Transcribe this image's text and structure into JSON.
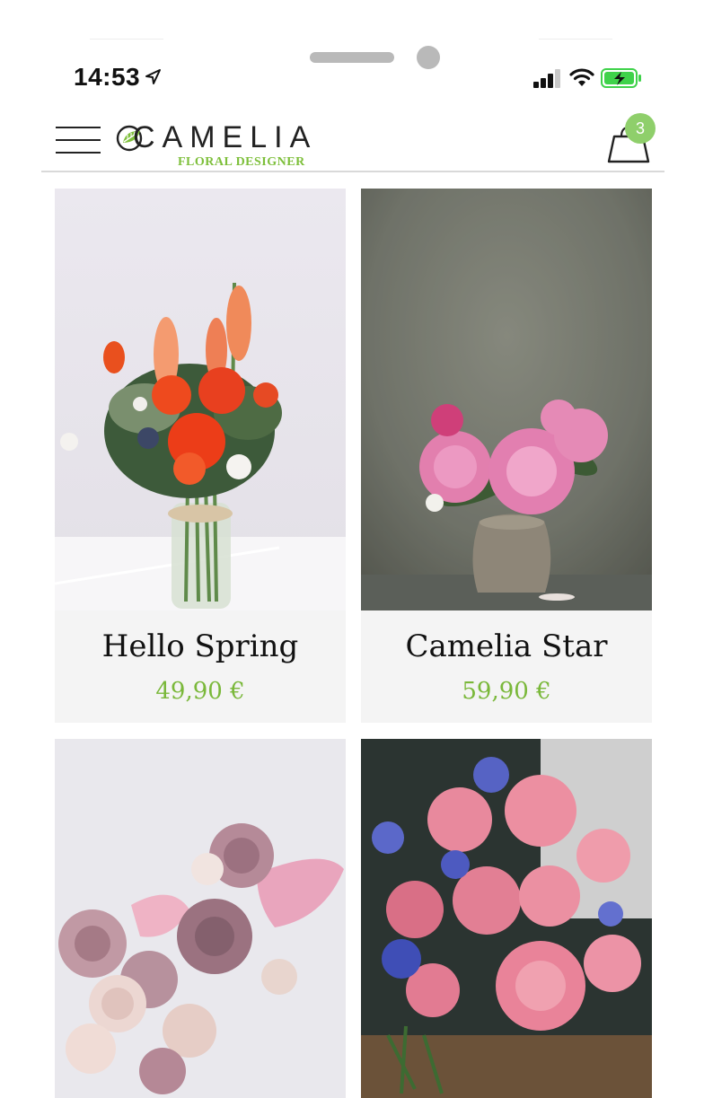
{
  "status_bar": {
    "time": "14:53",
    "icons": [
      "location-arrow-icon",
      "cellular-signal-icon",
      "wifi-icon",
      "battery-charging-icon"
    ],
    "battery_color": "#3fd24a"
  },
  "header": {
    "logo_name": "CAMELIA",
    "logo_subtitle": "FLORAL DESIGNER",
    "cart_count": "3",
    "accent_color": "#7dbf3a",
    "badge_color": "#8fcf6b"
  },
  "products": [
    {
      "name": "Hello Spring",
      "price": "49,90 €",
      "image": "orange-bouquet-in-glass-vase"
    },
    {
      "name": "Camelia Star",
      "price": "59,90 €",
      "image": "pink-peonies-in-clay-vase"
    },
    {
      "name": "",
      "price": "",
      "image": "dusty-pink-chrysanthemum-anthurium-bouquet"
    },
    {
      "name": "",
      "price": "",
      "image": "pink-roses-blue-cornflowers-bouquet"
    }
  ]
}
